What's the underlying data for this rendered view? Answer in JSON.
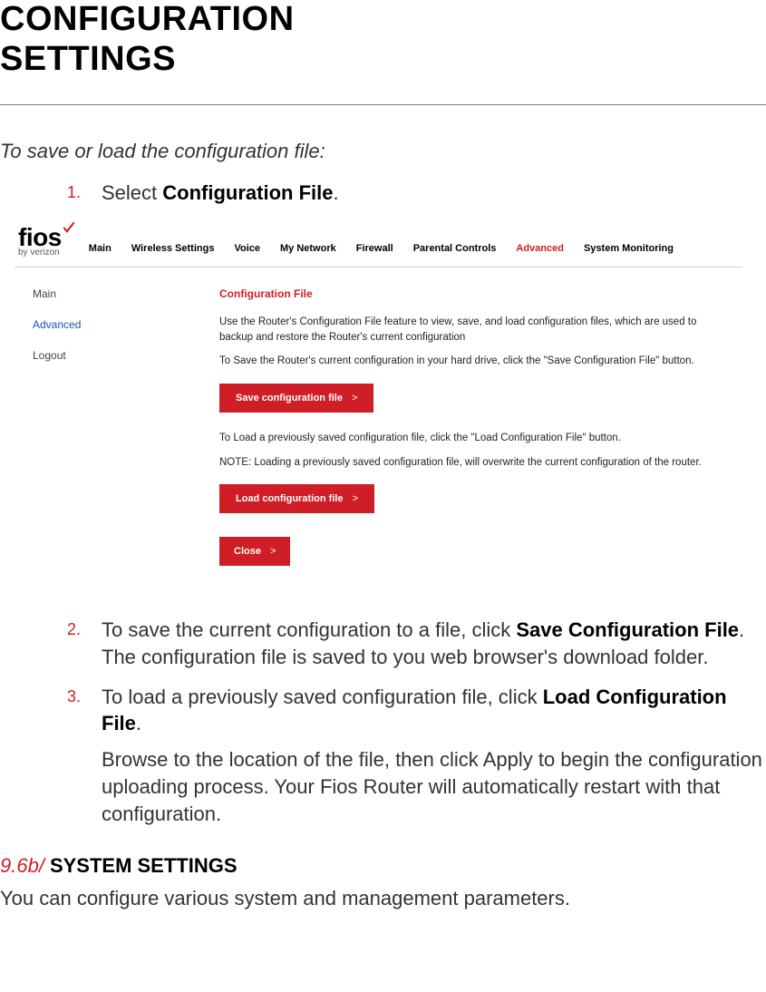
{
  "title_line1": "CONFIGURATION",
  "title_line2": "SETTINGS",
  "intro": "To save or load the configuration file:",
  "steps": {
    "s1": {
      "num": "1.",
      "text_pre": "Select ",
      "bold": "Configuration File",
      "text_post": "."
    },
    "s2": {
      "num": "2.",
      "text_pre": "To save the current configuration to a file, click ",
      "bold": "Save Configuration File",
      "text_post": ". The configuration file is saved to you web browser's download folder."
    },
    "s3": {
      "num": "3.",
      "text_pre": "To load a previously saved configuration file, click ",
      "bold": "Load Configuration File",
      "text_post": "."
    },
    "s3_extra_pre": "Browse to the location of the file, then click ",
    "s3_extra_bold": "Apply",
    "s3_extra_post": " to begin the configuration uploading process. Your Fios Router will automatically restart with that configuration."
  },
  "subsection": {
    "num": "9.6b/",
    "name": "SYSTEM SETTINGS"
  },
  "subsection_desc": "You can configure various system and management parameters.",
  "mock": {
    "logo_text": "fios",
    "logo_sub": "by verizon",
    "nav": [
      "Main",
      "Wireless Settings",
      "Voice",
      "My Network",
      "Firewall",
      "Parental Controls",
      "Advanced",
      "System Monitoring"
    ],
    "nav_active_index": 6,
    "side": {
      "items": [
        "Main",
        "Advanced",
        "Logout"
      ],
      "active_index": 1
    },
    "main": {
      "heading": "Configuration File",
      "p1": "Use the Router's Configuration File feature to view, save, and load configuration files, which are used to backup and restore the Router's current configuration",
      "p2": "To Save the Router's current configuration in your hard drive, click the \"Save Configuration File\" button.",
      "btn_save": "Save configuration file",
      "p3": "To Load a previously saved configuration file, click the \"Load Configuration File\" button.",
      "p4": "NOTE: Loading a previously saved configuration file, will overwrite the current configuration of the router.",
      "btn_load": "Load configuration file",
      "btn_close": "Close",
      "chevron": ">"
    }
  }
}
